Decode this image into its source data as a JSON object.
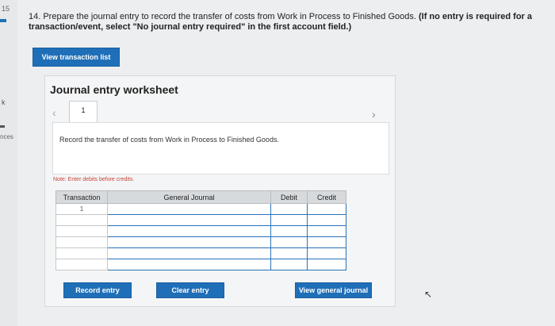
{
  "left_rail": {
    "question_number": "15",
    "star_label": "k",
    "text_fragment": "nces"
  },
  "question": {
    "main": "14. Prepare the journal entry to record the transfer of costs from Work in Process to Finished Goods.",
    "hint": "(If no entry is required for a transaction/event, select \"No journal entry required\" in the first account field.)"
  },
  "buttons": {
    "view_transaction_list": "View transaction list",
    "record_entry": "Record entry",
    "clear_entry": "Clear entry",
    "view_general_journal": "View general journal"
  },
  "worksheet": {
    "title": "Journal entry worksheet",
    "tab": "1",
    "nav_prev": "‹",
    "nav_next": "›",
    "instruction": "Record the transfer of costs from Work in Process to Finished Goods.",
    "note": "Note: Enter debits before credits."
  },
  "table": {
    "headers": {
      "transaction": "Transaction",
      "general_journal": "General Journal",
      "debit": "Debit",
      "credit": "Credit"
    },
    "rows": [
      "1",
      "",
      "",
      "",
      "",
      ""
    ]
  },
  "colors": {
    "accent": "#1f6fb8",
    "note": "#c6453a"
  }
}
